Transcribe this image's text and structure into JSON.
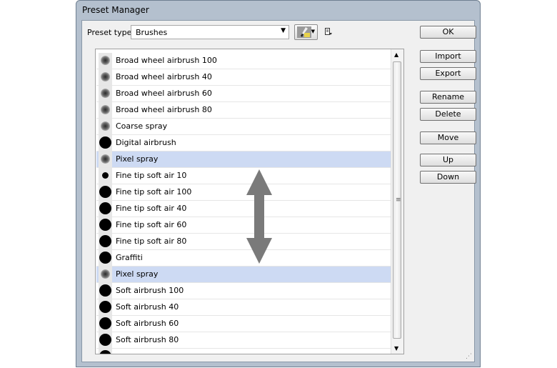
{
  "window": {
    "title": "Preset Manager"
  },
  "preset_type": {
    "label": "Preset type:",
    "value": "Brushes"
  },
  "buttons": {
    "ok": "OK",
    "import": "Import",
    "export": "Export",
    "rename": "Rename",
    "delete": "Delete",
    "move": "Move",
    "up": "Up",
    "down": "Down"
  },
  "presets": [
    {
      "name": "Broad wheel airbrush 100",
      "thumb": "air",
      "selected": false
    },
    {
      "name": "Broad wheel airbrush 40",
      "thumb": "air",
      "selected": false
    },
    {
      "name": "Broad wheel airbrush 60",
      "thumb": "air",
      "selected": false
    },
    {
      "name": "Broad wheel airbrush 80",
      "thumb": "air",
      "selected": false
    },
    {
      "name": "Coarse spray",
      "thumb": "air",
      "selected": false
    },
    {
      "name": "Digital airbrush",
      "thumb": "big",
      "selected": false
    },
    {
      "name": "Pixel spray",
      "thumb": "air",
      "selected": true
    },
    {
      "name": "Fine tip soft air 10",
      "thumb": "small",
      "selected": false
    },
    {
      "name": "Fine tip soft air 100",
      "thumb": "big",
      "selected": false
    },
    {
      "name": "Fine tip soft air 40",
      "thumb": "big",
      "selected": false
    },
    {
      "name": "Fine tip soft air 60",
      "thumb": "big",
      "selected": false
    },
    {
      "name": "Fine tip soft air 80",
      "thumb": "big",
      "selected": false
    },
    {
      "name": "Graffiti",
      "thumb": "big",
      "selected": false
    },
    {
      "name": "Pixel spray",
      "thumb": "air",
      "selected": true
    },
    {
      "name": "Soft airbrush 100",
      "thumb": "big",
      "selected": false
    },
    {
      "name": "Soft airbrush 40",
      "thumb": "big",
      "selected": false
    },
    {
      "name": "Soft airbrush 60",
      "thumb": "big",
      "selected": false
    },
    {
      "name": "Soft airbrush 80",
      "thumb": "big",
      "selected": false
    },
    {
      "name": "",
      "thumb": "big",
      "selected": false
    }
  ],
  "icons": {
    "brush_picker": "brush-icon",
    "panel_menu": "panel-menu-icon",
    "move_indicator": "double-arrow-icon"
  },
  "colors": {
    "selection": "#cddaf3",
    "arrow": "#7a7a7a",
    "frame": "#b4c0ce"
  }
}
